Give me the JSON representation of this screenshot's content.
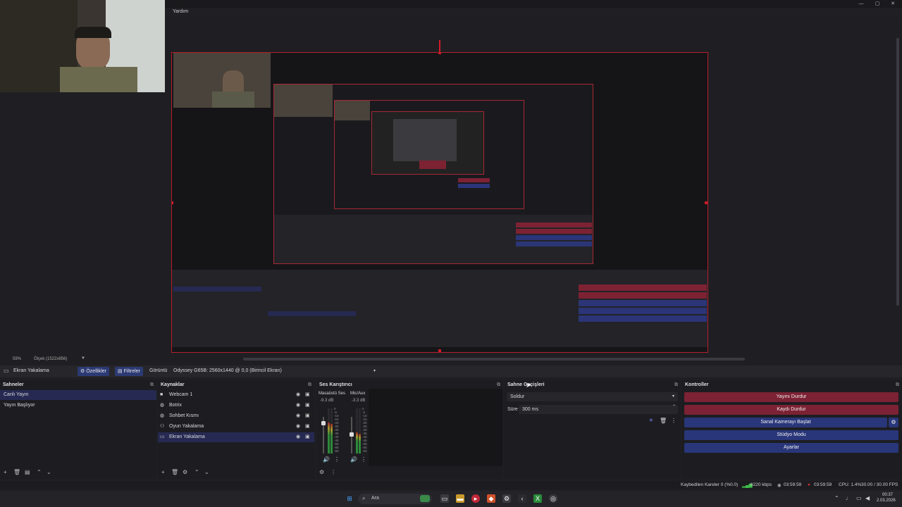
{
  "menu": {
    "help": "Yardım"
  },
  "zoom": {
    "percent": "59%",
    "scale_label": "Ölçek (1522x856)"
  },
  "context_bar": {
    "source_name": "Ekran Yakalama",
    "properties": "Özellikler",
    "filters": "Filtreler",
    "display_label": "Görüntü",
    "display_value": "Odyssey G65B: 2560x1440 @ 0,0 (Birincil Ekran)"
  },
  "scenes": {
    "title": "Sahneler",
    "items": [
      {
        "label": "Canlı Yayın",
        "selected": true
      },
      {
        "label": "Yayın Başlıyor",
        "selected": false
      }
    ]
  },
  "sources": {
    "title": "Kaynaklar",
    "items": [
      {
        "label": "Webcam 1",
        "icon": "camera-icon"
      },
      {
        "label": "Botrix",
        "icon": "globe-icon"
      },
      {
        "label": "Sohbet Kısmı",
        "icon": "globe-icon"
      },
      {
        "label": "Oyun Yakalama",
        "icon": "gamepad-icon"
      },
      {
        "label": "Ekran Yakalama",
        "icon": "monitor-icon"
      }
    ]
  },
  "mixer": {
    "title": "Ses Karıştırıcı",
    "channels": [
      {
        "name": "Masaüstü Ses",
        "db": "-9.3 dB"
      },
      {
        "name": "Mic/Aux",
        "db": "-3.3 dB"
      }
    ],
    "scale": [
      "0",
      "-5",
      "-10",
      "-15",
      "-20",
      "-25",
      "-30",
      "-35",
      "-40",
      "-45",
      "-50",
      "-55",
      "-60"
    ]
  },
  "transitions": {
    "title": "Sahne Geçişleri",
    "type": "Soldur",
    "duration_label": "Süre",
    "duration_value": "300 ms"
  },
  "controls": {
    "title": "Kontroller",
    "stop_stream": "Yayını Durdur",
    "stop_record": "Kaydı Durdur",
    "virtual_cam": "Sanal Kamerayı Başlat",
    "studio_mode": "Stüdyo Modu",
    "settings": "Ayarlar"
  },
  "status": {
    "dropped": "Kaybedilen Kareler 0 (%0.0)",
    "bitrate": "6220 kbps",
    "stream_time": "03:59:59",
    "record_time": "03:59:59",
    "cpu": "CPU: 1.4%",
    "fps": "30.00 / 30.00 FPS"
  },
  "taskbar": {
    "search": "Ara",
    "time": "00:37",
    "date": "2.03.2026"
  },
  "colors": {
    "accent_red": "#7c2234",
    "accent_blue": "#29367a",
    "selection": "#262a52",
    "preview_border": "#b3202a"
  }
}
